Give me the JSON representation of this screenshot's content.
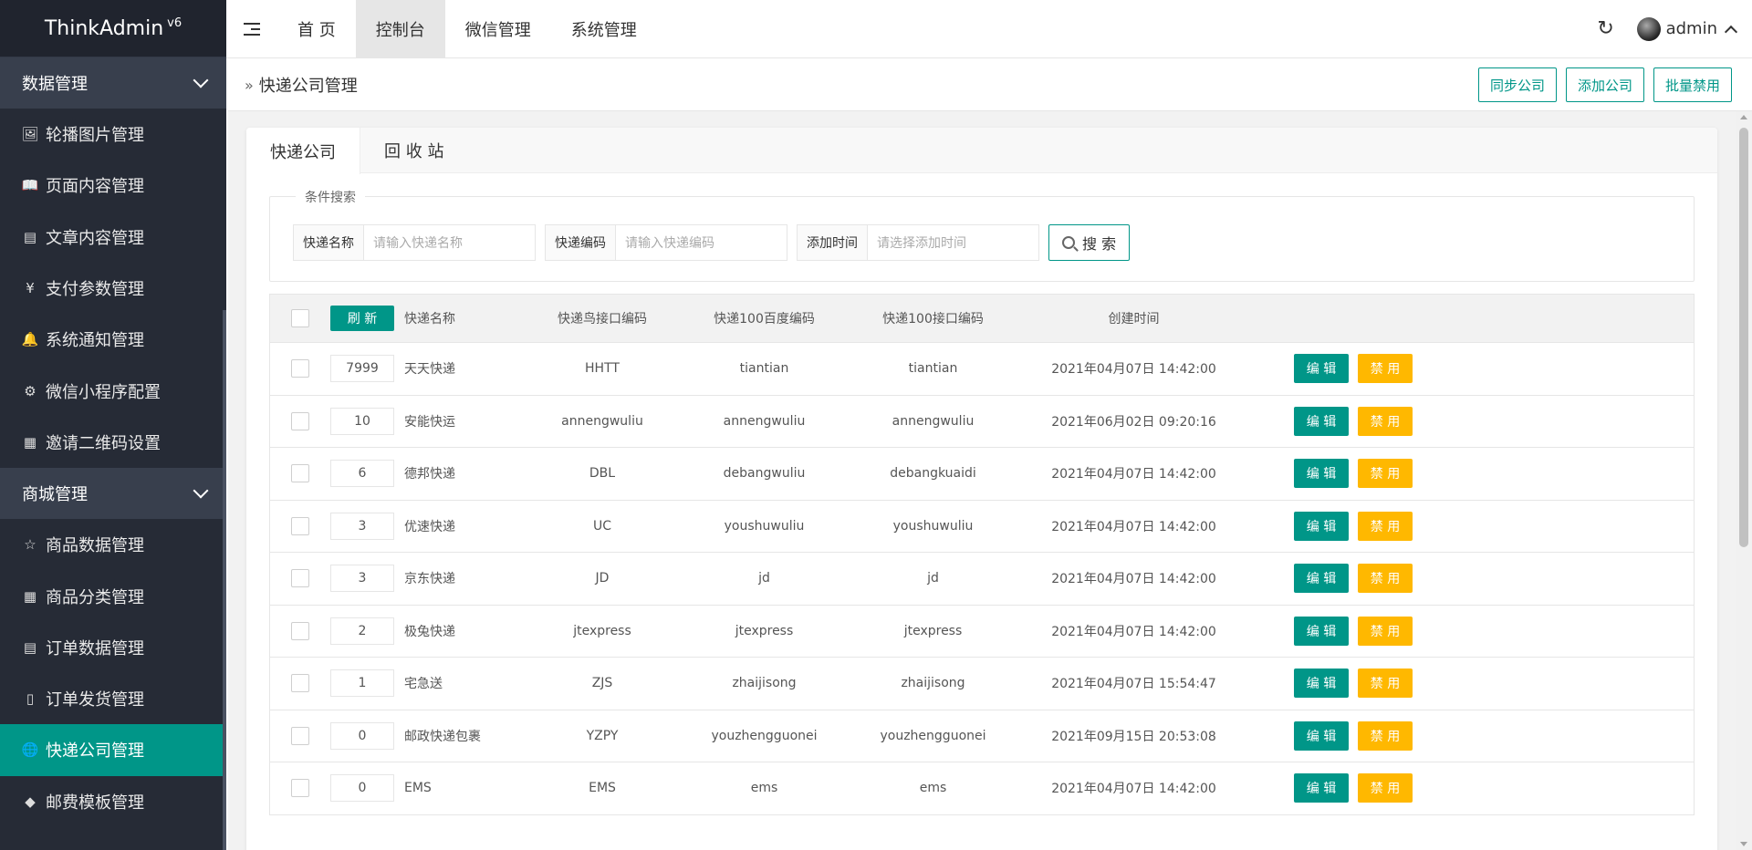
{
  "app": {
    "name": "ThinkAdmin",
    "version": "v6"
  },
  "sidebar": {
    "groups": [
      {
        "label": "数据管理"
      },
      {
        "label": "商城管理"
      }
    ],
    "items": [
      {
        "label": "轮播图片管理",
        "icon": "🖼"
      },
      {
        "label": "页面内容管理",
        "icon": "📖"
      },
      {
        "label": "文章内容管理",
        "icon": "▤"
      },
      {
        "label": "支付参数管理",
        "icon": "¥"
      },
      {
        "label": "系统通知管理",
        "icon": "🔔"
      },
      {
        "label": "微信小程序配置",
        "icon": "⚙"
      },
      {
        "label": "邀请二维码设置",
        "icon": "▦"
      },
      {
        "label": "商品数据管理",
        "icon": "☆"
      },
      {
        "label": "商品分类管理",
        "icon": "▦"
      },
      {
        "label": "订单数据管理",
        "icon": "▤"
      },
      {
        "label": "订单发货管理",
        "icon": "▯"
      },
      {
        "label": "快递公司管理",
        "icon": "🌐"
      },
      {
        "label": "邮费模板管理",
        "icon": "◆"
      }
    ]
  },
  "topnav": {
    "items": [
      {
        "label": "首 页"
      },
      {
        "label": "控制台"
      },
      {
        "label": "微信管理"
      },
      {
        "label": "系统管理"
      }
    ],
    "user": "admin"
  },
  "titlebar": {
    "title": "快递公司管理",
    "buttons": [
      "同步公司",
      "添加公司",
      "批量禁用"
    ]
  },
  "tabs": [
    "快递公司",
    "回 收 站"
  ],
  "search": {
    "legend": "条件搜索",
    "fields": [
      {
        "label": "快递名称",
        "placeholder": "请输入快递名称"
      },
      {
        "label": "快递编码",
        "placeholder": "请输入快递编码"
      },
      {
        "label": "添加时间",
        "placeholder": "请选择添加时间"
      }
    ],
    "button": "搜 索"
  },
  "table": {
    "refresh_label": "刷 新",
    "headers": [
      "快递名称",
      "快递鸟接口编码",
      "快递100百度编码",
      "快递100接口编码",
      "创建时间"
    ],
    "edit_label": "编 辑",
    "disable_label": "禁 用",
    "rows": [
      {
        "sort": "7999",
        "name": "天天快递",
        "kdn": "HHTT",
        "bd": "tiantian",
        "k100": "tiantian",
        "time": "2021年04月07日 14:42:00"
      },
      {
        "sort": "10",
        "name": "安能快运",
        "kdn": "annengwuliu",
        "bd": "annengwuliu",
        "k100": "annengwuliu",
        "time": "2021年06月02日 09:20:16"
      },
      {
        "sort": "6",
        "name": "德邦快递",
        "kdn": "DBL",
        "bd": "debangwuliu",
        "k100": "debangkuaidi",
        "time": "2021年04月07日 14:42:00"
      },
      {
        "sort": "3",
        "name": "优速快递",
        "kdn": "UC",
        "bd": "youshuwuliu",
        "k100": "youshuwuliu",
        "time": "2021年04月07日 14:42:00"
      },
      {
        "sort": "3",
        "name": "京东快递",
        "kdn": "JD",
        "bd": "jd",
        "k100": "jd",
        "time": "2021年04月07日 14:42:00"
      },
      {
        "sort": "2",
        "name": "极兔快递",
        "kdn": "jtexpress",
        "bd": "jtexpress",
        "k100": "jtexpress",
        "time": "2021年04月07日 14:42:00"
      },
      {
        "sort": "1",
        "name": "宅急送",
        "kdn": "ZJS",
        "bd": "zhaijisong",
        "k100": "zhaijisong",
        "time": "2021年04月07日 15:54:47"
      },
      {
        "sort": "0",
        "name": "邮政快递包裹",
        "kdn": "YZPY",
        "bd": "youzhengguonei",
        "k100": "youzhengguonei",
        "time": "2021年09月15日 20:53:08"
      },
      {
        "sort": "0",
        "name": "EMS",
        "kdn": "EMS",
        "bd": "ems",
        "k100": "ems",
        "time": "2021年04月07日 14:42:00"
      }
    ]
  }
}
